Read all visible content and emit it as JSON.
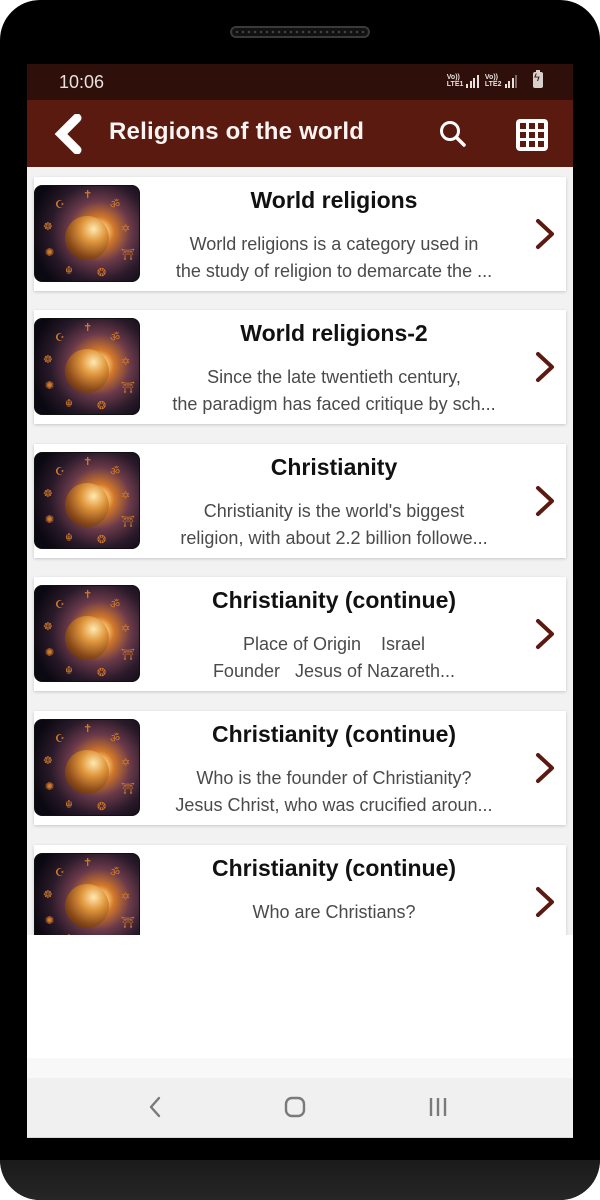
{
  "status_bar": {
    "time": "10:06",
    "sim1_label_top": "Vo))",
    "sim1_label_bottom": "LTE1",
    "sim2_label_top": "Vo))",
    "sim2_label_bottom": "LTE2",
    "icons": [
      "signal-icon",
      "signal-icon",
      "battery-charging-icon"
    ]
  },
  "app_bar": {
    "title": "Religions of the world",
    "back_icon": "chevron-left-icon",
    "search_icon": "search-icon",
    "grid_icon": "grid-icon"
  },
  "colors": {
    "status_bar_bg": "#2e0f0a",
    "app_bar_bg": "#5a1a10",
    "chevron": "#5a1a10",
    "title_text": "#111111",
    "desc_text": "#4a4a4a"
  },
  "items": [
    {
      "title": "World religions",
      "lines": [
        "World religions is a category used in",
        "the study of religion to demarcate the ..."
      ]
    },
    {
      "title": "World religions-2",
      "lines": [
        "Since the late twentieth century,",
        "the paradigm has faced critique by sch..."
      ]
    },
    {
      "title": "Christianity",
      "lines": [
        "Christianity is the world's biggest",
        "religion, with about 2.2 billion followe..."
      ]
    },
    {
      "title": "Christianity (continue)",
      "lines": [
        "Place of Origin    Israel",
        "Founder   Jesus of Nazareth..."
      ]
    },
    {
      "title": "Christianity (continue)",
      "lines": [
        "Who is the founder of Christianity?",
        "Jesus Christ, who was crucified aroun..."
      ]
    },
    {
      "title": "Christianity (continue)",
      "lines": [
        "Who are Christians?",
        ""
      ]
    }
  ],
  "nav_bar": {
    "back": "nav-back-icon",
    "home": "nav-home-icon",
    "recents": "nav-recents-icon"
  }
}
